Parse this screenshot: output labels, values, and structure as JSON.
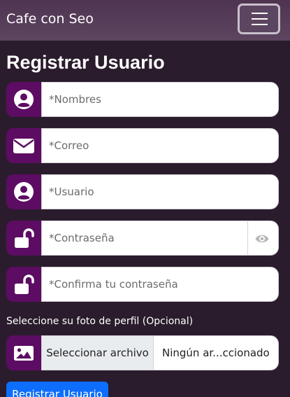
{
  "navbar": {
    "brand": "Cafe con Seo",
    "toggle_icon": "hamburger-menu-icon"
  },
  "page": {
    "title": "Registrar Usuario"
  },
  "form": {
    "fields": [
      {
        "icon": "user-circle-icon",
        "placeholder": "*Nombres"
      },
      {
        "icon": "envelope-icon",
        "placeholder": "*Correo"
      },
      {
        "icon": "user-circle-icon",
        "placeholder": "*Usuario"
      },
      {
        "icon": "unlock-icon",
        "placeholder": "*Contraseña",
        "toggle_icon": "eye-icon"
      },
      {
        "icon": "unlock-icon",
        "placeholder": "*Confirma tu contraseña"
      }
    ],
    "photo": {
      "label": "Seleccione su foto de perfil (Opcional)",
      "icon": "image-icon",
      "button_label": "Seleccionar archivo",
      "file_name": "Ningún ar...ccionado"
    },
    "submit_label": "Registrar Usuario"
  },
  "colors": {
    "background": "#2a1c2c",
    "navbar": "#573e5a",
    "addon": "#5c0c62",
    "primary_button": "#0d6efd"
  }
}
